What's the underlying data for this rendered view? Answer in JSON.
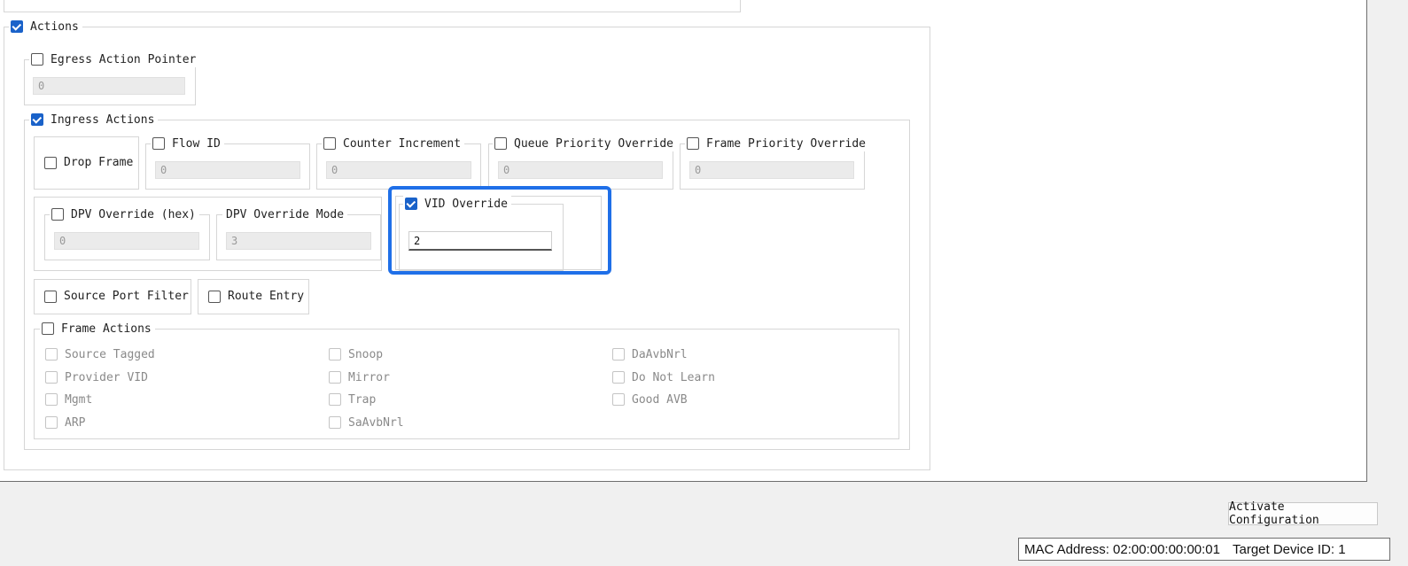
{
  "actions": {
    "label": "Actions",
    "checked": true,
    "egress": {
      "label": "Egress Action Pointer",
      "checked": false,
      "value": "0"
    },
    "ingress": {
      "label": "Ingress Actions",
      "checked": true,
      "drop_frame": {
        "label": "Drop Frame",
        "checked": false
      },
      "flow_id": {
        "label": "Flow ID",
        "checked": false,
        "value": "0"
      },
      "counter_increment": {
        "label": "Counter Increment",
        "checked": false,
        "value": "0"
      },
      "queue_priority_override": {
        "label": "Queue Priority Override",
        "checked": false,
        "value": "0"
      },
      "frame_priority_override": {
        "label": "Frame Priority Override",
        "checked": false,
        "value": "0"
      },
      "dpv_override_hex": {
        "label": "DPV Override (hex)",
        "checked": false,
        "value": "0"
      },
      "dpv_override_mode": {
        "label": "DPV Override Mode",
        "value": "3"
      },
      "vid_override": {
        "label": "VID Override",
        "checked": true,
        "value": "2"
      },
      "source_port_filter": {
        "label": "Source Port Filter",
        "checked": false
      },
      "route_entry": {
        "label": "Route Entry",
        "checked": false
      },
      "frame_actions": {
        "label": "Frame Actions",
        "checked": false,
        "items": [
          "Source Tagged",
          "Provider VID",
          "Mgmt",
          "ARP",
          "Snoop",
          "Mirror",
          "Trap",
          "SaAvbNrl",
          "DaAvbNrl",
          "Do Not Learn",
          "Good AVB"
        ]
      }
    }
  },
  "footer": {
    "activate_label": "Activate Configuration",
    "mac_address": "MAC Address: 02:00:00:00:00:01",
    "target_device": "Target Device ID: 1"
  },
  "colors": {
    "accent": "#1a62c9",
    "highlight": "#1f6fe8"
  }
}
